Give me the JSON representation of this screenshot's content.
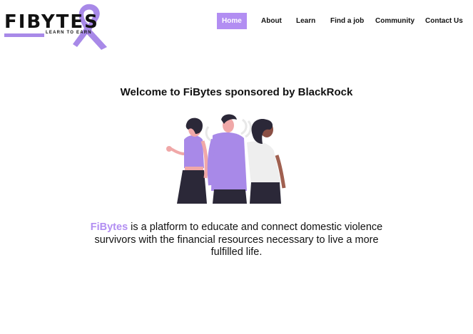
{
  "logo": {
    "wordmark": "FIBYTES",
    "tagline": "LEARN TO EARN",
    "icon": "ribbon-icon",
    "accent_color": "#b28ef2"
  },
  "nav": {
    "items": [
      {
        "label": "Home",
        "active": true
      },
      {
        "label": "About"
      },
      {
        "label": "Learn"
      },
      {
        "label": "Find a job"
      },
      {
        "label": "Community"
      },
      {
        "label": "Contact Us"
      }
    ]
  },
  "main": {
    "headline": "Welcome to FiBytes sponsored by BlackRock",
    "hero_image": "three-people-illustration",
    "description": {
      "brand": "FiBytes",
      "text": " is a platform to educate and connect domestic violence survivors with the financial resources necessary to live a more fulfilled life."
    }
  }
}
